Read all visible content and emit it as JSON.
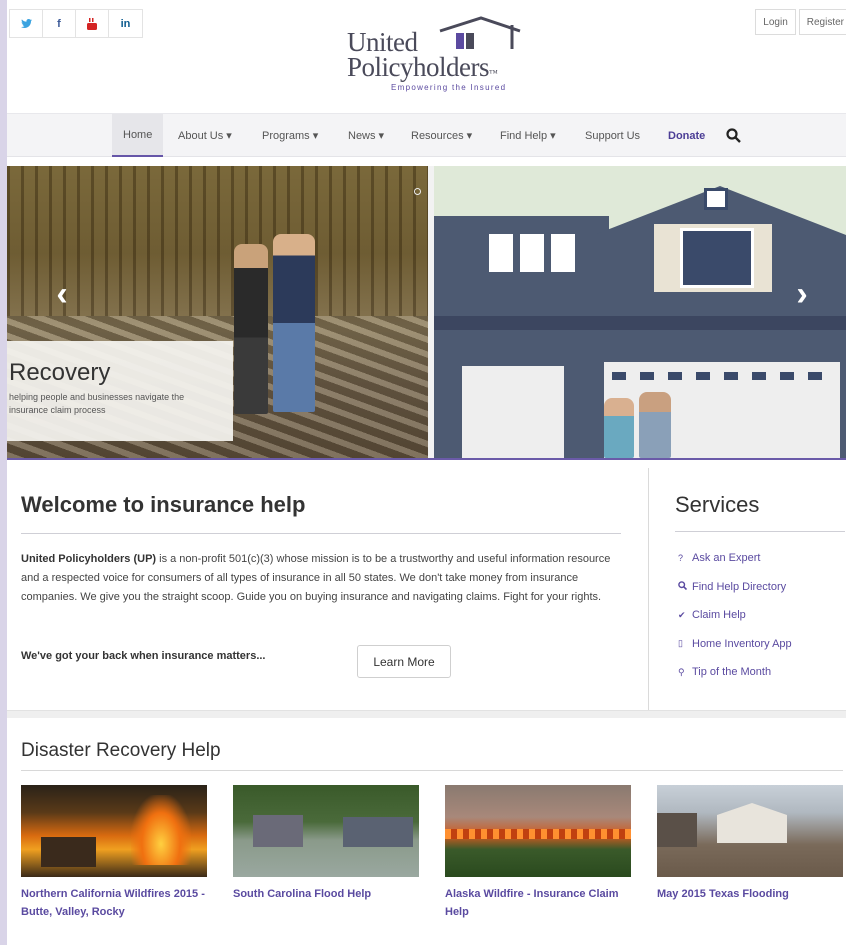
{
  "social": [
    {
      "name": "twitter-icon",
      "glyph": "🐦"
    },
    {
      "name": "facebook-icon",
      "glyph": "f"
    },
    {
      "name": "youtube-icon",
      "glyph": "▶"
    },
    {
      "name": "linkedin-icon",
      "glyph": "in"
    }
  ],
  "auth": {
    "login": "Login",
    "register": "Register"
  },
  "logo": {
    "line1": "United",
    "line2": "Policyholders",
    "tm": "™",
    "tagline": "Empowering the Insured"
  },
  "nav": {
    "home": "Home",
    "about": "About Us ▾",
    "programs": "Programs ▾",
    "news": "News ▾",
    "resources": "Resources ▾",
    "find_help": "Find Help ▾",
    "support": "Support Us",
    "donate": "Donate",
    "search_icon": "search-icon"
  },
  "hero": {
    "title": "Recovery",
    "subtitle": "helping people and businesses navigate the insurance claim process",
    "prev": "‹",
    "next": "›"
  },
  "welcome": {
    "title": "Welcome to insurance help",
    "org": "United Policyholders (UP)",
    "body": " is a non-profit 501(c)(3) whose mission is to be a trustworthy and useful information resource and a respected voice for consumers of all types of insurance in all 50 states. We don't take money from insurance companies. We give you the straight scoop. Guide you on buying insurance and navigating claims. Fight for your rights.",
    "tagline": "We've got your back when insurance matters...",
    "learn_more": "Learn More"
  },
  "services": {
    "title": "Services",
    "items": [
      {
        "icon": "?",
        "label": "Ask an Expert"
      },
      {
        "icon": "🔍",
        "label": "Find Help Directory"
      },
      {
        "icon": "✔",
        "label": "Claim Help"
      },
      {
        "icon": "▯",
        "label": "Home Inventory App"
      },
      {
        "icon": "⚲",
        "label": "Tip of the Month"
      }
    ]
  },
  "disaster": {
    "title": "Disaster Recovery Help",
    "cards": [
      {
        "label": "Northern California Wildfires 2015 - Butte, Valley, Rocky"
      },
      {
        "label": "South Carolina Flood Help"
      },
      {
        "label": "Alaska Wildfire - Insurance Claim Help"
      },
      {
        "label": "May 2015 Texas Flooding"
      }
    ]
  }
}
